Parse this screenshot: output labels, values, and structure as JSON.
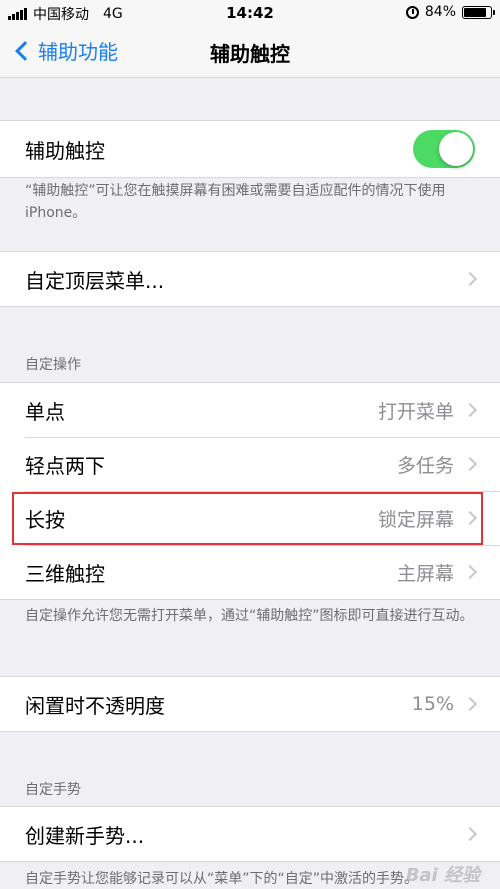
{
  "status_bar": {
    "carrier": "中国移动",
    "network": "4G",
    "time": "14:42",
    "battery": "84%",
    "battery_level": 0.84
  },
  "nav": {
    "back_label": "辅助功能",
    "title": "辅助触控"
  },
  "assistive_touch": {
    "label": "辅助触控",
    "enabled": true,
    "footer": "“辅助触控”可让您在触摸屏幕有困难或需要自适应配件的情况下使用 iPhone。"
  },
  "top_menu": {
    "label": "自定顶层菜单..."
  },
  "custom_actions": {
    "header": "自定操作",
    "items": [
      {
        "label": "单点",
        "value": "打开菜单"
      },
      {
        "label": "轻点两下",
        "value": "多任务"
      },
      {
        "label": "长按",
        "value": "锁定屏幕"
      },
      {
        "label": "三维触控",
        "value": "主屏幕"
      }
    ],
    "footer": "自定操作允许您无需打开菜单，通过“辅助触控”图标即可直接进行互动。"
  },
  "idle_opacity": {
    "label": "闲置时不透明度",
    "value": "15%"
  },
  "custom_gestures": {
    "header": "自定手势",
    "create_label": "创建新手势...",
    "footer": "自定手势让您能够记录可以从“菜单”下的“自定”中激活的手势。"
  },
  "watermark": "Bai 经验",
  "colors": {
    "accent": "#1a7ef5",
    "toggle_on": "#4cd964",
    "highlight": "#e5303a"
  }
}
